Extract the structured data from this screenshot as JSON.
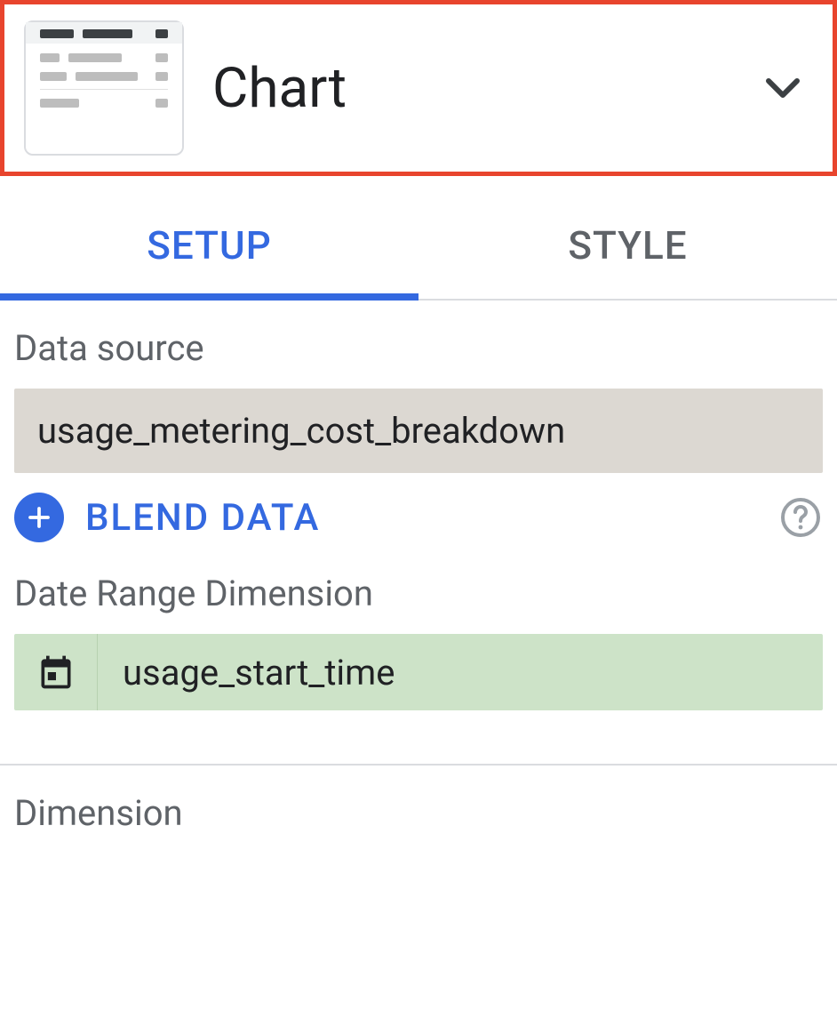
{
  "header": {
    "title": "Chart"
  },
  "tabs": {
    "setup": "SETUP",
    "style": "STYLE"
  },
  "setup": {
    "data_source_label": "Data source",
    "data_source_value": "usage_metering_cost_breakdown",
    "blend_data_label": "BLEND DATA",
    "date_range_label": "Date Range Dimension",
    "date_range_field": "usage_start_time",
    "dimension_label": "Dimension"
  }
}
